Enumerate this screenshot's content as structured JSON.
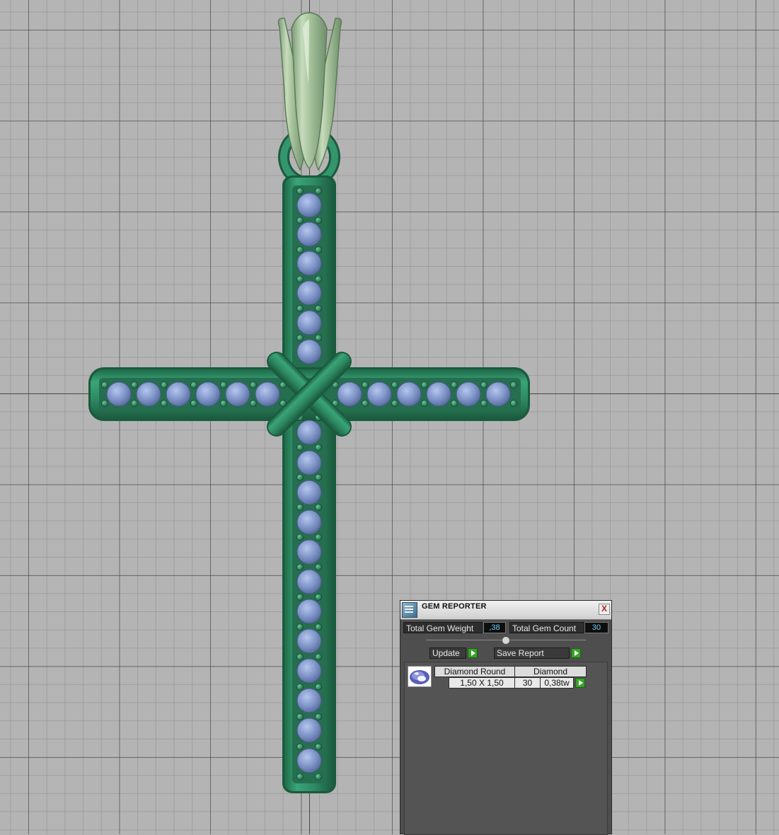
{
  "panel": {
    "title": "GEM REPORTER",
    "close_label": "X",
    "total_weight_label": "Total Gem Weight",
    "total_weight_value": ",38",
    "total_count_label": "Total Gem Count",
    "total_count_value": "30",
    "update_label": "Update",
    "save_report_label": "Save Report",
    "gem_row": {
      "name": "Diamond Round",
      "material": "Diamond",
      "size": "1,50 X 1,50",
      "count": "30",
      "weight": "0,38tw"
    }
  },
  "colors": {
    "metal": "#2f8a64",
    "metal_dark": "#1d5a40",
    "bail": "#a8c4a0",
    "gem": "#7f95c8",
    "viewport_bg": "#b4b4b4",
    "accent_green": "#3aa22a",
    "value_text": "#6fd0f0"
  },
  "icons": {
    "panel_logo": "gem-reporter-logo-icon",
    "close": "close-icon",
    "arrow": "play-arrow-icon",
    "gem_thumb": "diamond-gem-icon"
  }
}
